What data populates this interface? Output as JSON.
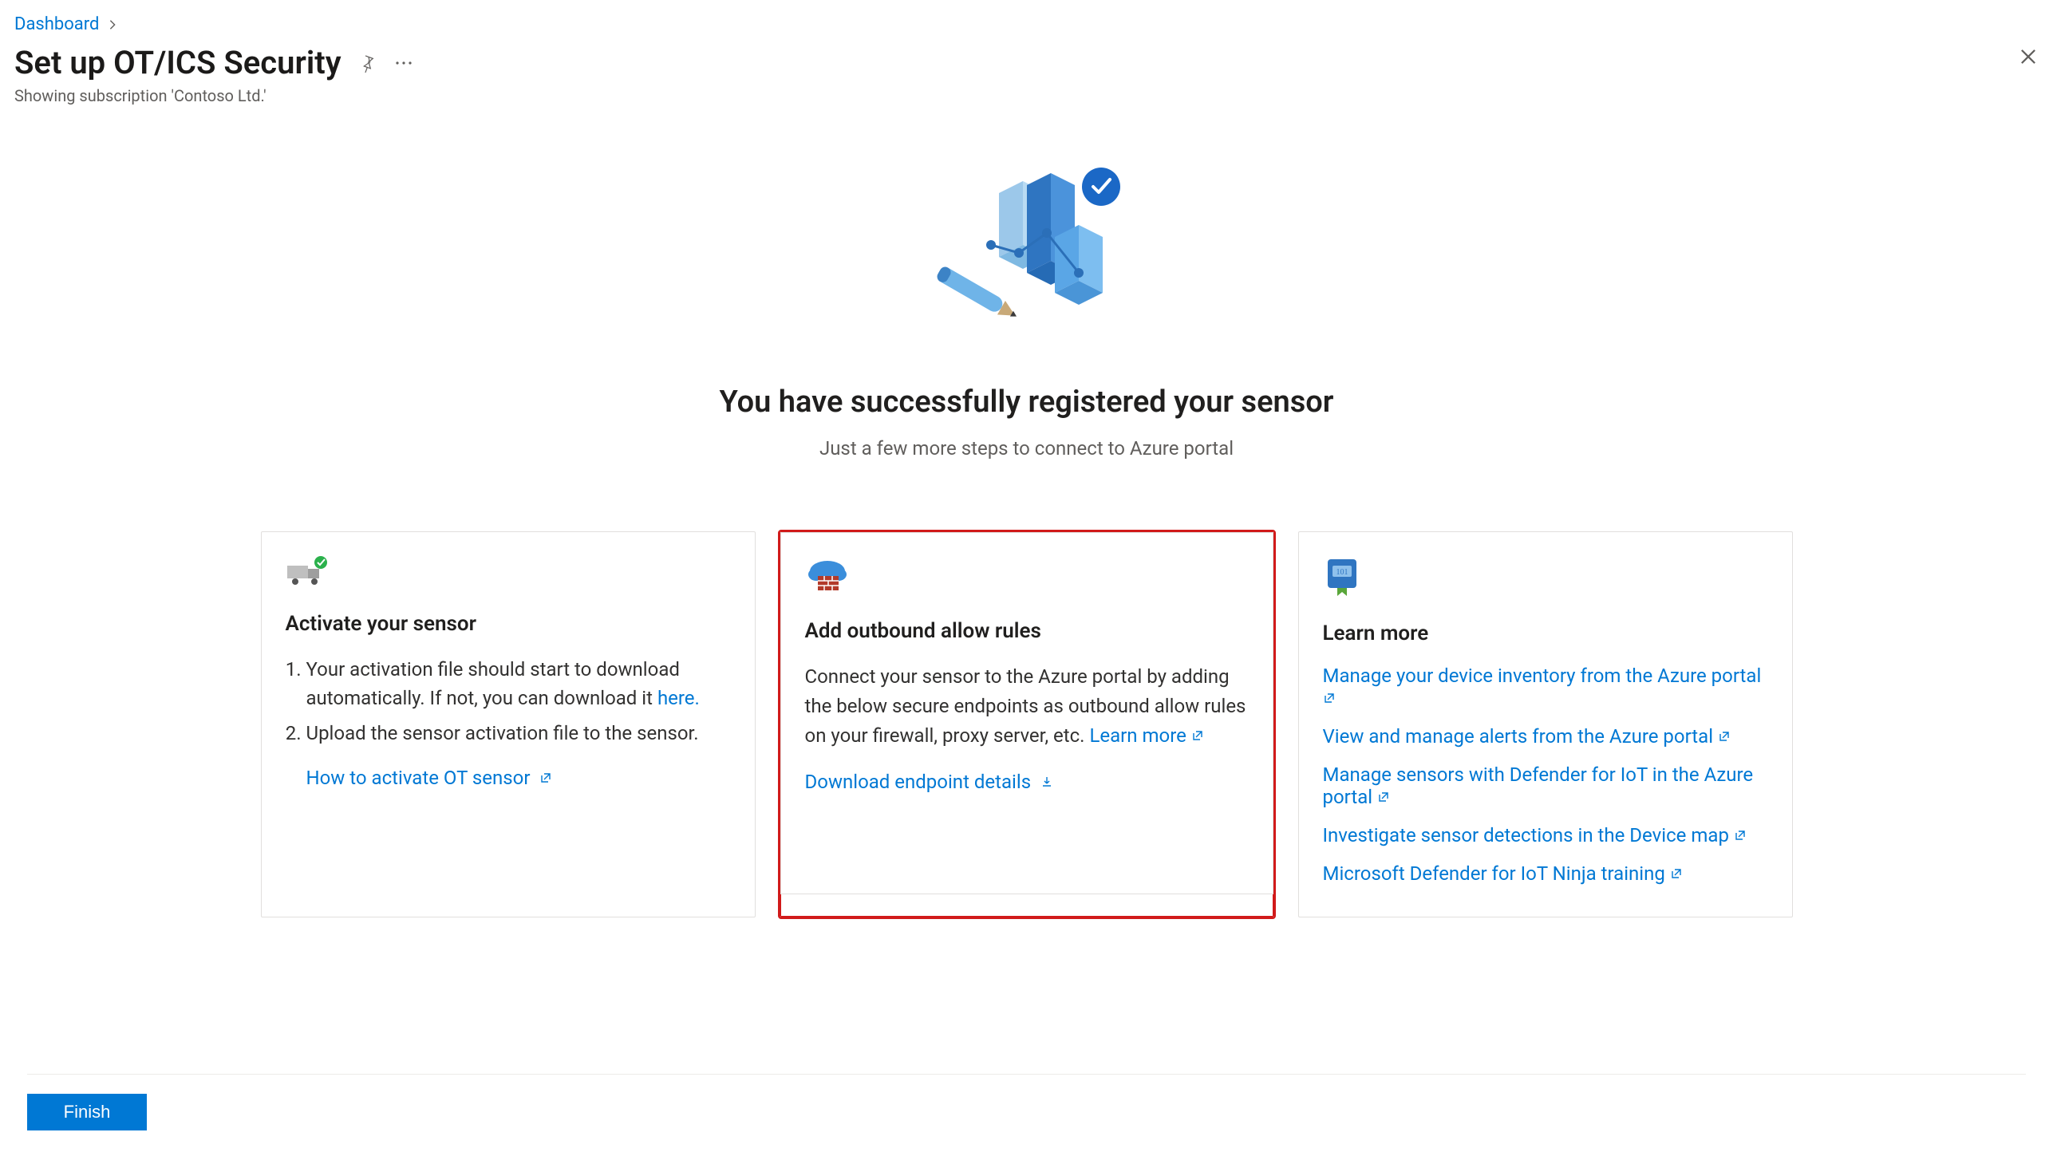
{
  "breadcrumb": {
    "item": "Dashboard"
  },
  "header": {
    "title": "Set up OT/ICS Security",
    "subtitle": "Showing subscription 'Contoso Ltd.'"
  },
  "hero": {
    "title": "You have successfully registered your sensor",
    "subtitle": "Just a few more steps to connect to Azure portal"
  },
  "cards": {
    "activate": {
      "title": "Activate your sensor",
      "step1_pre": "Your activation file should start to download automatically. If not, you can download it ",
      "step1_link": "here.",
      "step2": "Upload the sensor activation file to the sensor.",
      "howto_link": "How to activate OT sensor"
    },
    "outbound": {
      "title": "Add outbound allow rules",
      "body": "Connect your sensor to the Azure portal by adding the below secure endpoints as outbound allow rules on your firewall, proxy server, etc. ",
      "learn_more": "Learn more",
      "download_link": "Download endpoint details"
    },
    "learn": {
      "title": "Learn more",
      "links": [
        "Manage your device inventory from the Azure portal",
        "View and manage alerts from the Azure portal",
        "Manage sensors with Defender for IoT in the Azure portal",
        "Investigate sensor detections in the Device map",
        "Microsoft Defender for IoT Ninja training"
      ]
    }
  },
  "footer": {
    "finish_label": "Finish"
  }
}
